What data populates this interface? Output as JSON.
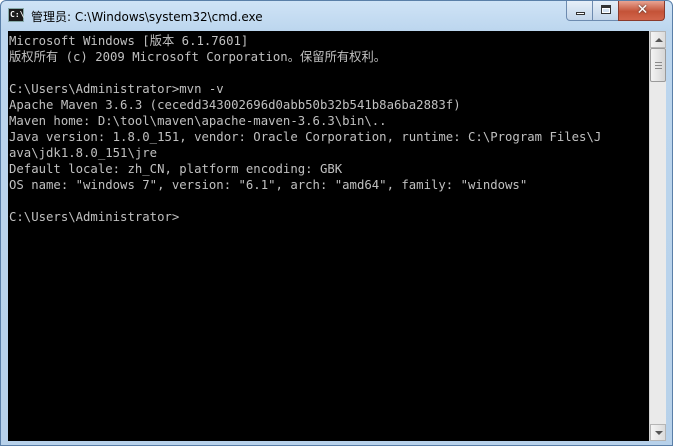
{
  "window": {
    "title": "管理员: C:\\Windows\\system32\\cmd.exe",
    "icon_text": "C:\\",
    "controls": {
      "minimize_icon": "minimize-icon",
      "maximize_icon": "maximize-icon",
      "close_icon": "close-icon",
      "close_glyph": "✕"
    }
  },
  "console": {
    "text_color": "#c0c0c0",
    "background_color": "#000000",
    "lines": [
      "Microsoft Windows [版本 6.1.7601]",
      "版权所有 (c) 2009 Microsoft Corporation。保留所有权利。",
      "",
      "C:\\Users\\Administrator>mvn -v",
      "Apache Maven 3.6.3 (cecedd343002696d0abb50b32b541b8a6ba2883f)",
      "Maven home: D:\\tool\\maven\\apache-maven-3.6.3\\bin\\..",
      "Java version: 1.8.0_151, vendor: Oracle Corporation, runtime: C:\\Program Files\\J",
      "ava\\jdk1.8.0_151\\jre",
      "Default locale: zh_CN, platform encoding: GBK",
      "OS name: \"windows 7\", version: \"6.1\", arch: \"amd64\", family: \"windows\"",
      "",
      "C:\\Users\\Administrator>"
    ]
  }
}
